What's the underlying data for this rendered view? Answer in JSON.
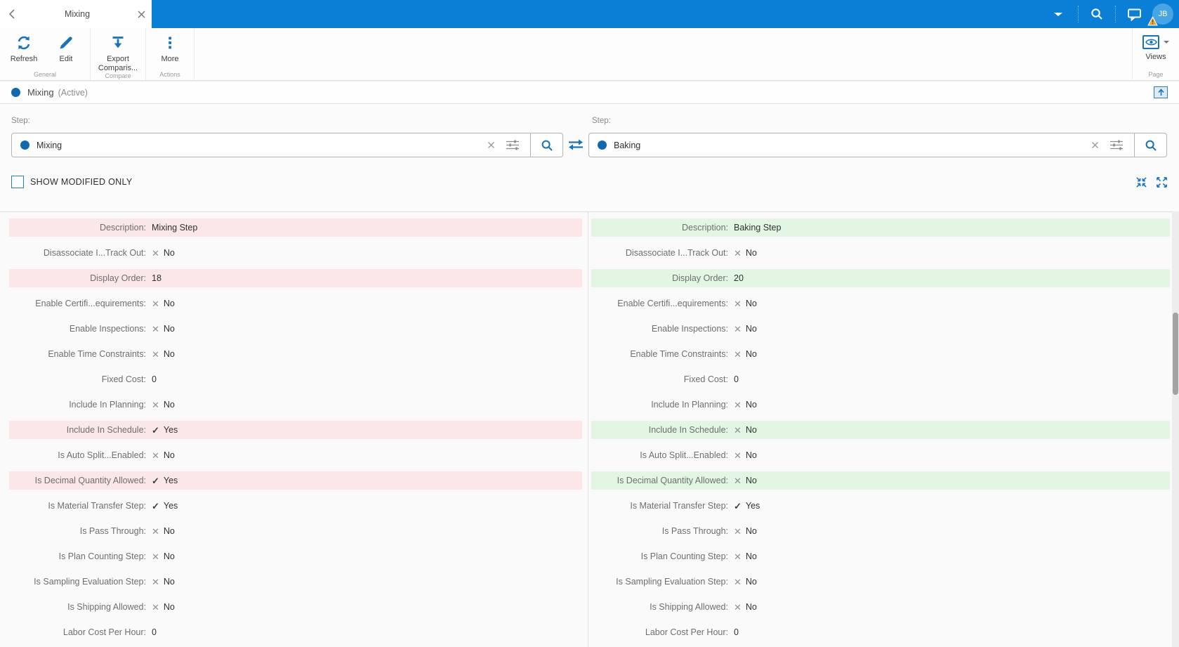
{
  "window": {
    "tab_title": "Mixing"
  },
  "topbar": {
    "user_initials": "JB"
  },
  "toolbar": {
    "groups": [
      {
        "label": "General",
        "buttons": [
          {
            "label": "Refresh"
          },
          {
            "label": "Edit"
          }
        ]
      },
      {
        "label": "Compare",
        "buttons": [
          {
            "label": "Export Comparis..."
          }
        ]
      },
      {
        "label": "Actions",
        "buttons": [
          {
            "label": "More"
          }
        ]
      }
    ],
    "right_group": {
      "label": "Page",
      "button_label": "Views"
    }
  },
  "record_header": {
    "title": "Mixing",
    "status": "(Active)"
  },
  "compare_panel": {
    "left": {
      "field_label": "Step:",
      "value": "Mixing"
    },
    "right": {
      "field_label": "Step:",
      "value": "Baking"
    },
    "show_modified_label": "SHOW MODIFIED ONLY",
    "show_modified_checked": false
  },
  "rows": [
    {
      "label": "Description:",
      "left_icon": "",
      "left_value": "Mixing Step",
      "right_icon": "",
      "right_value": "Baking Step",
      "modified": true
    },
    {
      "label": "Disassociate I...Track Out:",
      "left_icon": "x",
      "left_value": "No",
      "right_icon": "x",
      "right_value": "No",
      "modified": false
    },
    {
      "label": "Display Order:",
      "left_icon": "",
      "left_value": "18",
      "right_icon": "",
      "right_value": "20",
      "modified": true
    },
    {
      "label": "Enable Certifi...equirements:",
      "left_icon": "x",
      "left_value": "No",
      "right_icon": "x",
      "right_value": "No",
      "modified": false
    },
    {
      "label": "Enable Inspections:",
      "left_icon": "x",
      "left_value": "No",
      "right_icon": "x",
      "right_value": "No",
      "modified": false
    },
    {
      "label": "Enable Time Constraints:",
      "left_icon": "x",
      "left_value": "No",
      "right_icon": "x",
      "right_value": "No",
      "modified": false
    },
    {
      "label": "Fixed Cost:",
      "left_icon": "",
      "left_value": "0",
      "right_icon": "",
      "right_value": "0",
      "modified": false
    },
    {
      "label": "Include In Planning:",
      "left_icon": "x",
      "left_value": "No",
      "right_icon": "x",
      "right_value": "No",
      "modified": false
    },
    {
      "label": "Include In Schedule:",
      "left_icon": "check",
      "left_value": "Yes",
      "right_icon": "x",
      "right_value": "No",
      "modified": true
    },
    {
      "label": "Is Auto Split...Enabled:",
      "left_icon": "x",
      "left_value": "No",
      "right_icon": "x",
      "right_value": "No",
      "modified": false
    },
    {
      "label": "Is Decimal Quantity Allowed:",
      "left_icon": "check",
      "left_value": "Yes",
      "right_icon": "x",
      "right_value": "No",
      "modified": true
    },
    {
      "label": "Is Material Transfer Step:",
      "left_icon": "check",
      "left_value": "Yes",
      "right_icon": "check",
      "right_value": "Yes",
      "modified": false
    },
    {
      "label": "Is Pass Through:",
      "left_icon": "x",
      "left_value": "No",
      "right_icon": "x",
      "right_value": "No",
      "modified": false
    },
    {
      "label": "Is Plan Counting Step:",
      "left_icon": "x",
      "left_value": "No",
      "right_icon": "x",
      "right_value": "No",
      "modified": false
    },
    {
      "label": "Is Sampling Evaluation Step:",
      "left_icon": "x",
      "left_value": "No",
      "right_icon": "x",
      "right_value": "No",
      "modified": false
    },
    {
      "label": "Is Shipping Allowed:",
      "left_icon": "x",
      "left_value": "No",
      "right_icon": "x",
      "right_value": "No",
      "modified": false
    },
    {
      "label": "Labor Cost Per Hour:",
      "left_icon": "",
      "left_value": "0",
      "right_icon": "",
      "right_value": "0",
      "modified": false
    }
  ],
  "colors": {
    "accent_blue": "#0b7fd6",
    "icon_blue": "#1a72b8",
    "modified_left_highlight": "#fbe6e8",
    "modified_right_highlight": "#e3f6e4"
  }
}
